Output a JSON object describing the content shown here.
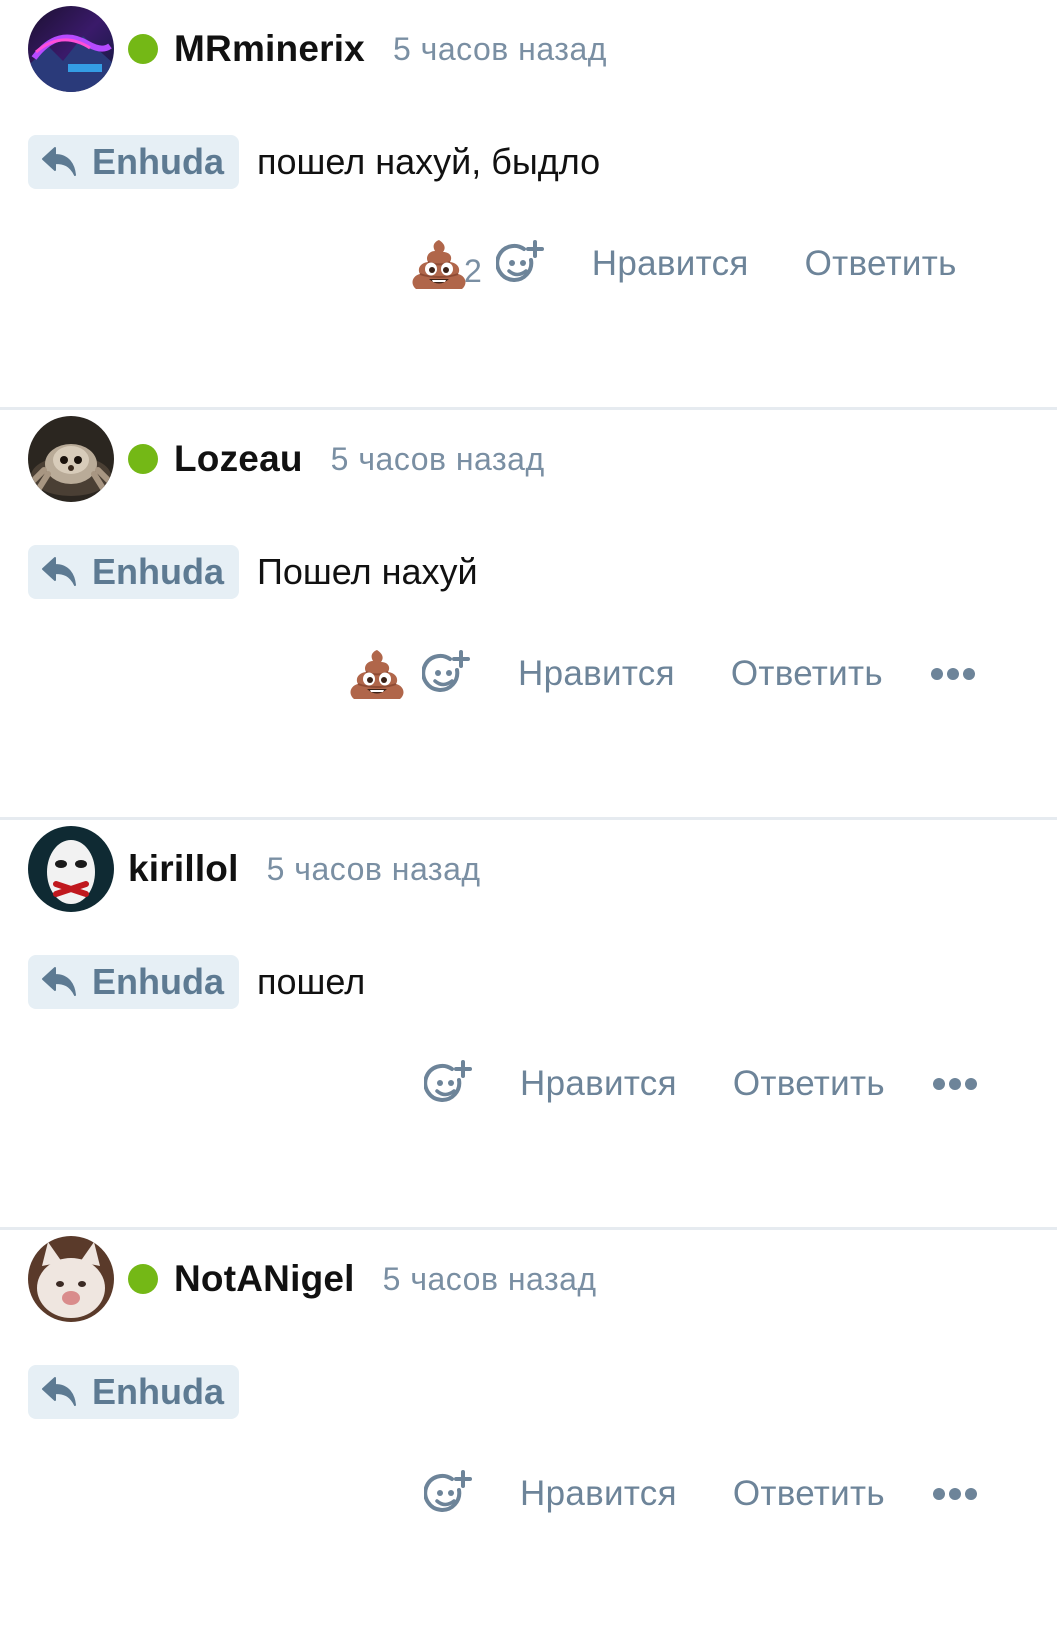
{
  "colors": {
    "online": "#74b816",
    "muted": "#7a8fa3",
    "link": "#6d8499",
    "chip_bg": "#e6eff5",
    "chip_text": "#5d7a92",
    "divider": "#e6ebf0"
  },
  "comments": [
    {
      "username": "MRminerix",
      "online": true,
      "time": "5 часов назад",
      "reply_to": "Enhuda",
      "text": "пошел нахуй, быдло",
      "reaction": {
        "icon": "poop-emoji",
        "count": "2"
      },
      "like_label": "Нравится",
      "reply_label": "Ответить",
      "has_more_menu": false
    },
    {
      "username": "Lozeau",
      "online": true,
      "time": "5 часов назад",
      "reply_to": "Enhuda",
      "text": "Пошел нахуй",
      "reaction": {
        "icon": "poop-emoji",
        "count": ""
      },
      "like_label": "Нравится",
      "reply_label": "Ответить",
      "has_more_menu": true
    },
    {
      "username": "kirillol",
      "online": false,
      "time": "5 часов назад",
      "reply_to": "Enhuda",
      "text": "пошел",
      "reaction": null,
      "like_label": "Нравится",
      "reply_label": "Ответить",
      "has_more_menu": true
    },
    {
      "username": "NotANigel",
      "online": true,
      "time": "5 часов назад",
      "reply_to": "Enhuda",
      "text": "",
      "reaction": null,
      "like_label": "Нравится",
      "reply_label": "Ответить",
      "has_more_menu": true
    }
  ]
}
